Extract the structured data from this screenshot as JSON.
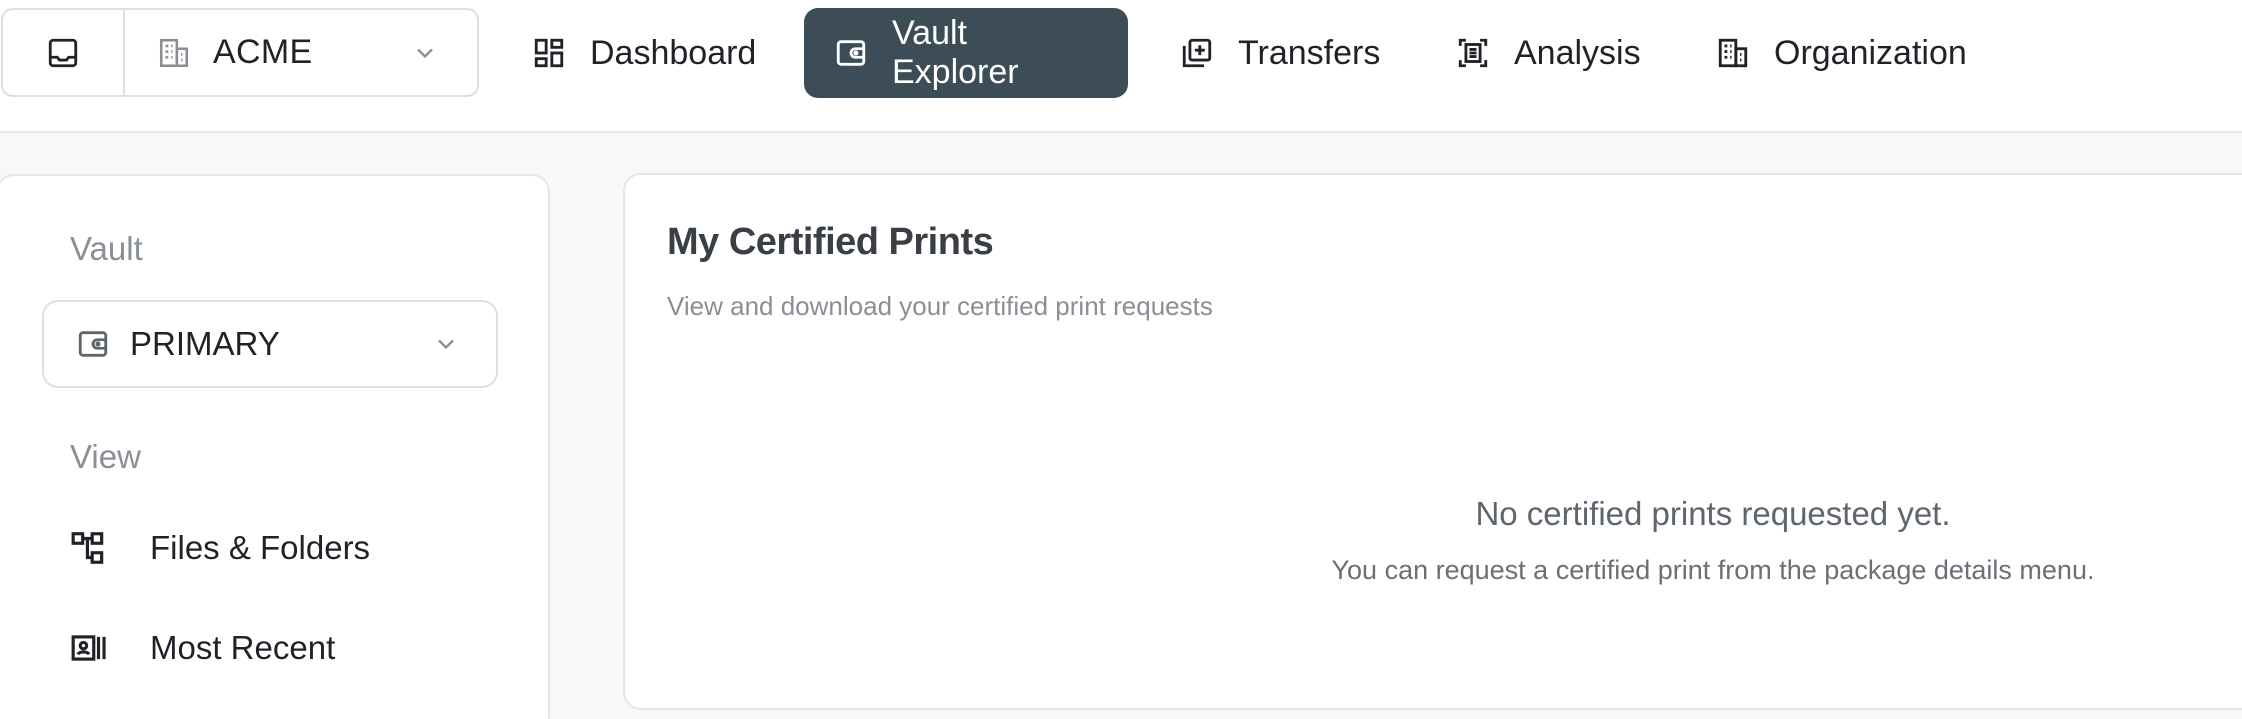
{
  "workspace": {
    "org_name": "ACME"
  },
  "nav": {
    "items": [
      {
        "label": "Dashboard",
        "icon": "dashboard-icon"
      },
      {
        "label": "Vault Explorer",
        "icon": "vault-icon",
        "active": true
      },
      {
        "label": "Transfers",
        "icon": "transfers-icon"
      },
      {
        "label": "Analysis",
        "icon": "analysis-icon"
      },
      {
        "label": "Organization",
        "icon": "building-icon"
      }
    ]
  },
  "sidebar": {
    "vault_heading": "Vault",
    "vault_selected": "PRIMARY",
    "view_heading": "View",
    "links": [
      {
        "label": "Files & Folders",
        "icon": "tree-icon"
      },
      {
        "label": "Most Recent",
        "icon": "recent-icon"
      }
    ]
  },
  "main": {
    "title": "My Certified Prints",
    "subtitle": "View and download your certified print requests",
    "empty_title": "No certified prints requested yet.",
    "empty_subtitle": "You can request a certified print from the package details menu."
  },
  "colors": {
    "active_nav_bg": "#3d4d57",
    "page_bg": "#f7f8fa",
    "muted_text": "#8a8f96"
  }
}
